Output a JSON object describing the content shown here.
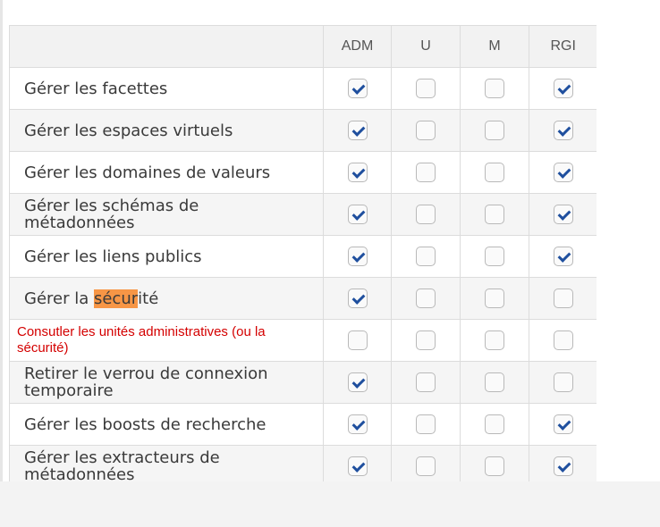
{
  "columns": [
    {
      "key": "adm",
      "label": "ADM"
    },
    {
      "key": "u",
      "label": "U"
    },
    {
      "key": "m",
      "label": "M"
    },
    {
      "key": "rgi",
      "label": "RGI"
    }
  ],
  "rows": [
    {
      "label": "Gérer les facettes",
      "adm": true,
      "u": false,
      "m": false,
      "rgi": true
    },
    {
      "label": "Gérer les espaces virtuels",
      "adm": true,
      "u": false,
      "m": false,
      "rgi": true
    },
    {
      "label": "Gérer les domaines de valeurs",
      "adm": true,
      "u": false,
      "m": false,
      "rgi": true
    },
    {
      "label": "Gérer les schémas de métadonnées",
      "adm": true,
      "u": false,
      "m": false,
      "rgi": true
    },
    {
      "label": "Gérer les liens publics",
      "adm": true,
      "u": false,
      "m": false,
      "rgi": true
    },
    {
      "label_parts": [
        "Gérer la ",
        "sécur",
        "ité"
      ],
      "adm": true,
      "u": false,
      "m": false,
      "rgi": false
    },
    {
      "label": "Consutler les unités administratives (ou la sécurité)",
      "adm": false,
      "u": false,
      "m": false,
      "rgi": false
    },
    {
      "label": "Retirer le verrou de connexion temporaire",
      "adm": true,
      "u": false,
      "m": false,
      "rgi": false
    },
    {
      "label": "Gérer les boosts de recherche",
      "adm": true,
      "u": false,
      "m": false,
      "rgi": true
    },
    {
      "label": "Gérer les extracteurs de métadonnées",
      "adm": true,
      "u": false,
      "m": false,
      "rgi": true
    }
  ],
  "colors": {
    "check": "#1f4f9e",
    "highlight": "#f79646",
    "annotation": "#d40000"
  }
}
